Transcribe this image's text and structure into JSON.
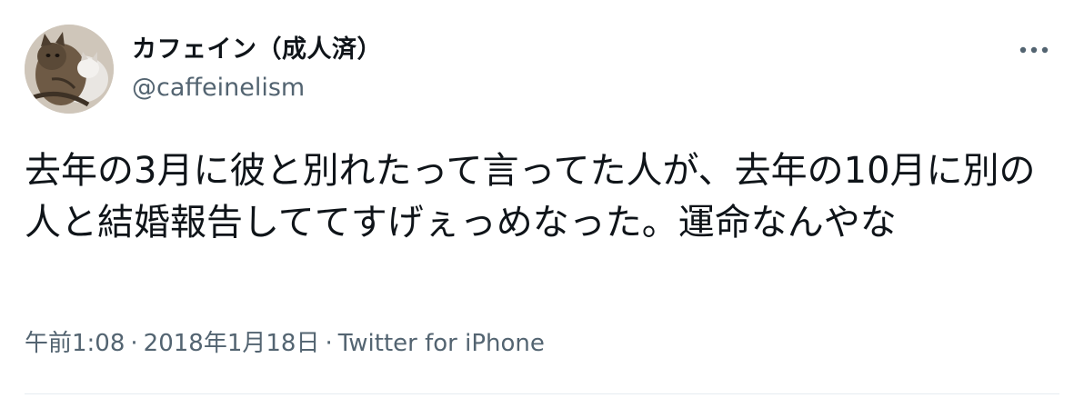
{
  "tweet": {
    "author": {
      "display_name": "カフェイン（成人済）",
      "handle": "@caffeinelism",
      "avatar_icon": "cat-photo-avatar"
    },
    "more_icon": "more-options-icon",
    "text": "去年の3月に彼と別れたって言ってた人が、去年の10月に別の人と結婚報告しててすげぇっめなった。運命なんやな",
    "meta": {
      "time": "午前1:08",
      "date": "2018年1月18日",
      "source": "Twitter for iPhone",
      "separator": "·"
    }
  }
}
